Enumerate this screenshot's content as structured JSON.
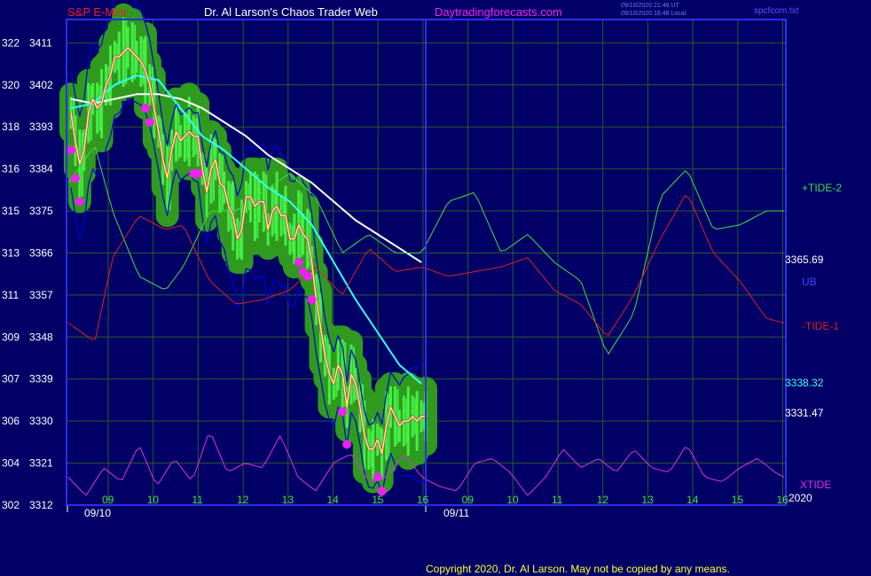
{
  "header": {
    "instrument": "S&P E-Mini",
    "site": "Dr. Al Larson's Chaos Trader Web",
    "domain": "Daytradingforecasts.com",
    "ts1": "09/10/2020 21:48 UT",
    "ts2": "09/10/2020 16:48 Local",
    "file": "spcfcom.txt"
  },
  "footer": {
    "copyright": "Copyright 2020, Dr. Al Larson. May not be copied by any means."
  },
  "colors": {
    "background": "#000066",
    "frame": "#2e2ef0",
    "grid": "#2a5a2a",
    "price": "#ffff22",
    "price_range": "#44ee44",
    "glow": "#2f9a1e",
    "dots": "#ee22ee",
    "white_ma": "#ffffff",
    "cyan_ma": "#33ffff",
    "band": "#0000dd",
    "tide_green": "#44dd44",
    "tide_red": "#dd2222",
    "xtide": "#dd33dd",
    "header_red": "#ee2222",
    "header_magenta": "#ee22ee"
  },
  "chart_data": {
    "type": "line",
    "y_left_ticks": [
      "322",
      "320",
      "318",
      "316",
      "315",
      "313",
      "311",
      "309",
      "307",
      "306",
      "304",
      "302"
    ],
    "y_price_ticks": [
      3411,
      3402,
      3393,
      3384,
      3375,
      3366,
      3357,
      3348,
      3339,
      3330,
      3321,
      3312
    ],
    "ylim": [
      3312,
      3416
    ],
    "x_hour_ticks": [
      "09",
      "10",
      "11",
      "12",
      "13",
      "14",
      "15",
      "16",
      "09",
      "10",
      "11",
      "12",
      "13",
      "14",
      "15",
      "16"
    ],
    "date_labels": [
      "09/10",
      "09/11"
    ],
    "year_label": "2020",
    "right_labels": {
      "tide2": "+TIDE-2",
      "close_value": "3365.69",
      "ub": "UB",
      "tide1": "-TIDE-1",
      "cyan_value": "3338.32",
      "last_value": "3331.47",
      "xtide": "XTIDE"
    },
    "series": [
      {
        "name": "price",
        "x": [
          0,
          1,
          2,
          3,
          4,
          5,
          6,
          7,
          8,
          9,
          10,
          11,
          12,
          13,
          14,
          15,
          16,
          17,
          18,
          19,
          20,
          21,
          22,
          23,
          24,
          25,
          26,
          27,
          28,
          29,
          30,
          31,
          32,
          33,
          34,
          35,
          36,
          37,
          38,
          39,
          40,
          41,
          42,
          43,
          44,
          45,
          46,
          47,
          48,
          49,
          50,
          51,
          52,
          53,
          54,
          55,
          56,
          57,
          58,
          59,
          60,
          61,
          62,
          63,
          64,
          65,
          66,
          67,
          68,
          69,
          70,
          71,
          72,
          73,
          74,
          75,
          76,
          77,
          78,
          79,
          80,
          81
        ],
        "values": [
          3396,
          3390,
          3385,
          3388,
          3396,
          3399,
          3397,
          3398,
          3402,
          3404,
          3408,
          3408,
          3409,
          3410,
          3409,
          3408,
          3407,
          3405,
          3402,
          3397,
          3392,
          3386,
          3382,
          3388,
          3392,
          3390,
          3391,
          3392,
          3391,
          3391,
          3384,
          3379,
          3384,
          3386,
          3381,
          3380,
          3376,
          3374,
          3369,
          3371,
          3378,
          3378,
          3376,
          3377,
          3377,
          3371,
          3375,
          3376,
          3374,
          3374,
          3369,
          3369,
          3372,
          3370,
          3369,
          3364,
          3356,
          3350,
          3344,
          3340,
          3338,
          3342,
          3340,
          3333,
          3340,
          3338,
          3333,
          3327,
          3324,
          3324,
          3326,
          3323,
          3329,
          3333,
          3331,
          3329,
          3330,
          3330,
          3331,
          3330,
          3331,
          3331
        ]
      },
      {
        "name": "",
        "color": "white",
        "x": [
          0,
          5,
          10,
          15,
          20,
          25,
          30,
          35,
          40,
          45,
          50,
          55,
          60,
          65,
          70,
          75,
          80
        ],
        "values": [
          3399,
          3398,
          3399,
          3400,
          3400,
          3399,
          3397,
          3394,
          3391,
          3387,
          3384,
          3381,
          3377,
          3373,
          3370,
          3367,
          3364
        ]
      },
      {
        "name": "",
        "color": "cyan",
        "x": [
          0,
          5,
          10,
          15,
          20,
          25,
          30,
          35,
          40,
          45,
          50,
          55,
          60,
          65,
          70,
          75,
          80
        ],
        "values": [
          3397,
          3398,
          3402,
          3404,
          3403,
          3397,
          3391,
          3388,
          3384,
          3380,
          3377,
          3372,
          3364,
          3356,
          3349,
          3342,
          3338
        ]
      },
      {
        "name": "+TIDE-2",
        "color": "green",
        "x": [
          0,
          3,
          5,
          8,
          11,
          13,
          16,
          19,
          22,
          25,
          28,
          31,
          34,
          37,
          40,
          43,
          46,
          49,
          52,
          55,
          58,
          61,
          64,
          67,
          70,
          73,
          76,
          79,
          81
        ],
        "values": [
          3381,
          3389,
          3375,
          3361,
          3358,
          3363,
          3375,
          3375,
          3379,
          3383,
          3378,
          3366,
          3370,
          3366,
          3366,
          3377,
          3379,
          3366,
          3370,
          3364,
          3360,
          3344,
          3353,
          3378,
          3384,
          3371,
          3372,
          3375,
          3375
        ]
      },
      {
        "name": "-TIDE-1",
        "color": "red",
        "x": [
          0,
          3,
          5,
          8,
          11,
          13,
          16,
          19,
          22,
          25,
          28,
          31,
          34,
          37,
          40,
          43,
          46,
          49,
          52,
          55,
          58,
          61,
          64,
          67,
          70,
          73,
          76,
          79,
          81
        ],
        "values": [
          3351,
          3347,
          3365,
          3374,
          3371,
          3372,
          3360,
          3355,
          3356,
          3358,
          3363,
          3357,
          3367,
          3362,
          3363,
          3361,
          3362,
          3363,
          3365,
          3358,
          3355,
          3348,
          3357,
          3369,
          3379,
          3366,
          3360,
          3352,
          3351
        ]
      },
      {
        "name": "XTIDE",
        "color": "magenta",
        "x": [
          0,
          2,
          4,
          6,
          8,
          10,
          12,
          14,
          16,
          18,
          20,
          22,
          24,
          26,
          28,
          30,
          32,
          34,
          36,
          38,
          40,
          42,
          44,
          46,
          48,
          50,
          52,
          54,
          56,
          58,
          60,
          62,
          64,
          66,
          68,
          70,
          72,
          74,
          76,
          78,
          80,
          81
        ],
        "values": [
          3318,
          3314,
          3320,
          3317,
          3325,
          3316,
          3322,
          3317,
          3328,
          3319,
          3321,
          3320,
          3327,
          3318,
          3315,
          3321,
          3323,
          3317,
          3318,
          3323,
          3318,
          3316,
          3315,
          3321,
          3322,
          3319,
          3314,
          3318,
          3324,
          3320,
          3322,
          3319,
          3324,
          3320,
          3319,
          3325,
          3318,
          3317,
          3320,
          3322,
          3319,
          3318
        ]
      }
    ]
  }
}
